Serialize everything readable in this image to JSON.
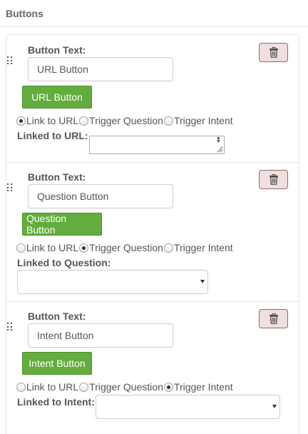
{
  "header": {
    "title": "Buttons"
  },
  "buttons": [
    {
      "text_label": "Button Text:",
      "text_value": "URL Button",
      "preview_label": "URL Button",
      "options": [
        "Link to URL",
        "Trigger Question",
        "Trigger Intent"
      ],
      "selected": "Link to URL",
      "linked_label": "Linked to URL:",
      "linked_value": ""
    },
    {
      "text_label": "Button Text:",
      "text_value": "Question Button",
      "preview_label": "Question Button",
      "options": [
        "Link to URL",
        "Trigger Question",
        "Trigger Intent"
      ],
      "selected": "Trigger Question",
      "linked_label": "Linked to Question:",
      "linked_value": ""
    },
    {
      "text_label": "Button Text:",
      "text_value": "Intent Button",
      "preview_label": "Intent Button",
      "options": [
        "Link to URL",
        "Trigger Question",
        "Trigger Intent"
      ],
      "selected": "Trigger Intent",
      "linked_label": "Linked to Intent:",
      "linked_value": ""
    }
  ],
  "colors": {
    "preview_button_bg": "#62ad3d",
    "delete_button_bg": "#f1dede",
    "border": "#e3e3e3"
  },
  "icons": {
    "delete": "trash-icon",
    "drag": "drag-handle-icon"
  }
}
